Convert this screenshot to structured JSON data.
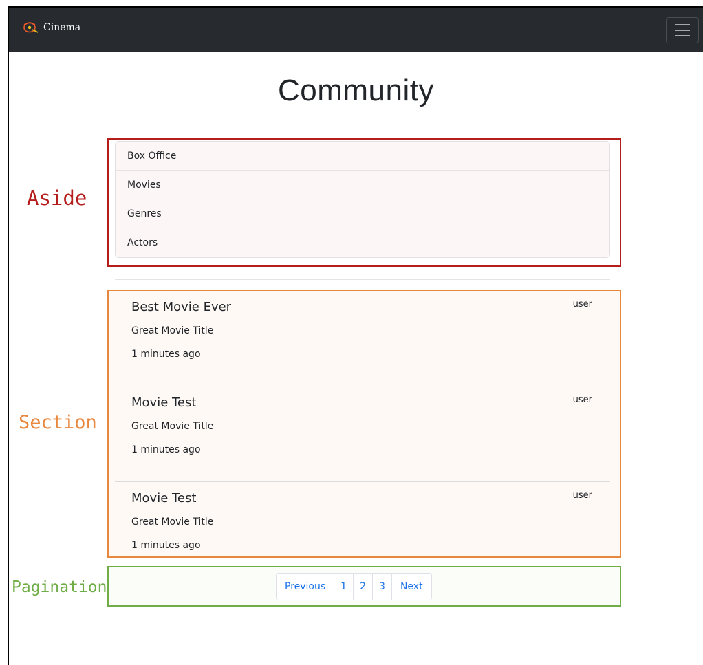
{
  "navbar": {
    "brand": "Cinema",
    "brand_icon": "film-reel-logo-icon",
    "menu_icon": "hamburger-menu-icon"
  },
  "page_title": "Community",
  "annotations": {
    "aside": "Aside",
    "section": "Section",
    "pagination": "Pagination"
  },
  "aside": {
    "items": [
      {
        "label": "Box Office"
      },
      {
        "label": "Movies"
      },
      {
        "label": "Genres"
      },
      {
        "label": "Actors"
      }
    ]
  },
  "posts": [
    {
      "title": "Best Movie Ever",
      "subtitle": "Great Movie Title",
      "time": "1 minutes ago",
      "user": "user"
    },
    {
      "title": "Movie Test",
      "subtitle": "Great Movie Title",
      "time": "1 minutes ago",
      "user": "user"
    },
    {
      "title": "Movie Test",
      "subtitle": "Great Movie Title",
      "time": "1 minutes ago",
      "user": "user"
    }
  ],
  "pagination": {
    "previous": "Previous",
    "pages": [
      "1",
      "2",
      "3"
    ],
    "next": "Next"
  },
  "colors": {
    "navbar": "#272a2e",
    "aside_annotation": "#b51c1c",
    "section_annotation": "#e8883f",
    "pagination_annotation": "#70ad47",
    "link": "#1a73e8"
  }
}
